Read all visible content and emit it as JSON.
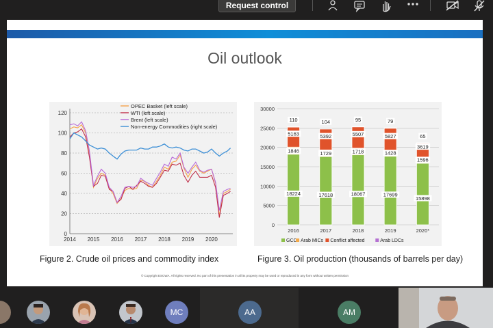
{
  "toolbar": {
    "request_control_label": "Request control",
    "icons": [
      "people-icon",
      "chat-icon",
      "raise-hand-icon",
      "more-icon",
      "camera-off-icon",
      "mic-off-icon"
    ]
  },
  "slide": {
    "title": "Oil outlook",
    "fig2_caption": "Figure 2. Crude oil prices and commodity index",
    "fig3_caption": "Figure 3. Oil production (thousands of barrels per day)",
    "copyright": "© Copyright ESCWA. All rights reserved. No part of this presentation in all its property may be used or reproduced in any form without written permission"
  },
  "chart_data": [
    {
      "type": "line",
      "ylim": [
        0,
        120
      ],
      "yticks": [
        "0",
        "20",
        "40",
        "60",
        "80",
        "100",
        "120"
      ],
      "xticks": [
        "2014",
        "2015",
        "2016",
        "2017",
        "2018",
        "2019",
        "2020"
      ],
      "xlim": [
        2014,
        2020.9
      ],
      "grid": "horizontal dashed",
      "legend_position": "top-right",
      "x": [
        2014.0,
        2014.17,
        2014.33,
        2014.5,
        2014.67,
        2014.83,
        2015.0,
        2015.17,
        2015.33,
        2015.5,
        2015.67,
        2015.83,
        2016.0,
        2016.17,
        2016.33,
        2016.5,
        2016.67,
        2016.83,
        2017.0,
        2017.17,
        2017.33,
        2017.5,
        2017.67,
        2017.83,
        2018.0,
        2018.17,
        2018.33,
        2018.5,
        2018.67,
        2018.83,
        2019.0,
        2019.17,
        2019.33,
        2019.5,
        2019.67,
        2019.83,
        2020.0,
        2020.17,
        2020.33,
        2020.5,
        2020.67,
        2020.8
      ],
      "series": [
        {
          "name": "OPEC Basket (left scale)",
          "color": "#f5a24b",
          "values": [
            104,
            106,
            105,
            108,
            100,
            80,
            46,
            55,
            60,
            58,
            45,
            40,
            30,
            35,
            43,
            45,
            44,
            45,
            53,
            52,
            48,
            46,
            52,
            58,
            66,
            64,
            71,
            72,
            78,
            65,
            56,
            64,
            68,
            62,
            60,
            62,
            64,
            50,
            18,
            40,
            42,
            44
          ]
        },
        {
          "name": "WTI (left scale)",
          "color": "#c0304a",
          "values": [
            96,
            100,
            101,
            104,
            96,
            76,
            47,
            50,
            58,
            57,
            44,
            42,
            31,
            34,
            45,
            47,
            44,
            48,
            52,
            50,
            47,
            46,
            50,
            56,
            63,
            62,
            69,
            68,
            70,
            58,
            51,
            58,
            62,
            56,
            56,
            56,
            58,
            46,
            16,
            38,
            40,
            42
          ]
        },
        {
          "name": "Brent (left scale)",
          "color": "#b768d8",
          "values": [
            108,
            109,
            107,
            111,
            102,
            82,
            48,
            57,
            64,
            60,
            46,
            42,
            31,
            37,
            46,
            47,
            46,
            47,
            55,
            52,
            50,
            48,
            55,
            61,
            69,
            67,
            76,
            74,
            80,
            66,
            60,
            66,
            71,
            63,
            61,
            63,
            64,
            51,
            23,
            42,
            44,
            45
          ]
        },
        {
          "name": "Non-energy Commodities (right scale)",
          "color": "#3c8fd6",
          "values": [
            94,
            100,
            98,
            96,
            92,
            88,
            86,
            84,
            85,
            84,
            80,
            77,
            74,
            79,
            82,
            83,
            83,
            83,
            85,
            84,
            84,
            86,
            86,
            87,
            89,
            86,
            85,
            86,
            85,
            83,
            82,
            84,
            84,
            82,
            80,
            81,
            84,
            80,
            77,
            80,
            82,
            85
          ]
        }
      ]
    },
    {
      "type": "bar",
      "stacked": true,
      "categories": [
        "2016",
        "2017",
        "2018",
        "2019",
        "2020*"
      ],
      "ylim": [
        0,
        30000
      ],
      "yticks": [
        "0",
        "5000",
        "10000",
        "15000",
        "20000",
        "25000",
        "30000"
      ],
      "legend_position": "bottom",
      "series": [
        {
          "name": "GCC",
          "color": "#8dc04a",
          "values": [
            18224,
            17618,
            18067,
            17699,
            15898
          ]
        },
        {
          "name": "Arab MICs",
          "color": "#f3a94a",
          "values": [
            1846,
            1729,
            1718,
            1428,
            1596
          ]
        },
        {
          "name": "Conflict affected",
          "color": "#e0532b",
          "values": [
            5163,
            5392,
            5507,
            5827,
            3619
          ]
        },
        {
          "name": "Arab LDCs",
          "color": "#b571d2",
          "values": [
            110,
            104,
            95,
            79,
            65
          ]
        }
      ]
    }
  ],
  "participants": [
    {
      "type": "photo",
      "name": "participant-1"
    },
    {
      "type": "photo",
      "name": "participant-2"
    },
    {
      "type": "photo",
      "name": "participant-3"
    },
    {
      "type": "initials",
      "initials": "MC",
      "color": "#6f7ebd"
    },
    {
      "type": "initials",
      "initials": "AA",
      "color": "#4c6a8e"
    },
    {
      "type": "initials",
      "initials": "AM",
      "color": "#4a7d65"
    },
    {
      "type": "video",
      "name": "presenter-video"
    }
  ]
}
